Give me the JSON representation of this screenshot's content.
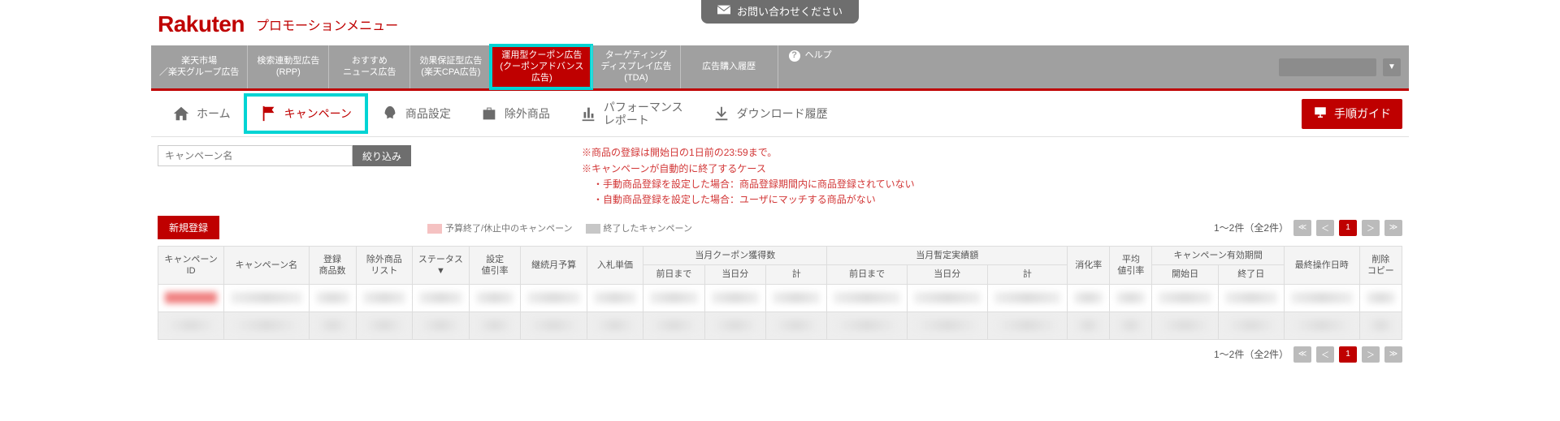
{
  "contact_label": "お問い合わせください",
  "logo": "Rakuten",
  "page_title": "プロモーションメニュー",
  "gnav": [
    {
      "l1": "楽天市場",
      "l2": "／楽天グループ広告"
    },
    {
      "l1": "検索連動型広告",
      "l2": "(RPP)"
    },
    {
      "l1": "おすすめ",
      "l2": "ニュース広告"
    },
    {
      "l1": "効果保証型広告",
      "l2": "(楽天CPA広告)"
    },
    {
      "l1": "運用型クーポン広告",
      "l2": "(クーポンアドバンス",
      "l3": "広告)"
    },
    {
      "l1": "ターゲティング",
      "l2": "ディスプレイ広告",
      "l3": "(TDA)"
    },
    {
      "l1": "広告購入履歴",
      "l2": ""
    },
    {
      "l1": "ヘルプ",
      "l2": ""
    }
  ],
  "snav": {
    "home": "ホーム",
    "campaign": "キャンペーン",
    "product": "商品設定",
    "exclude": "除外商品",
    "perf_l1": "パフォーマンス",
    "perf_l2": "レポート",
    "download": "ダウンロード履歴",
    "guide": "手順ガイド"
  },
  "search": {
    "placeholder": "キャンペーン名",
    "button": "絞り込み"
  },
  "notes": {
    "l1": "※商品の登録は開始日の1日前の23:59まで。",
    "l2": "※キャンペーンが自動的に終了するケース",
    "l3": "・手動商品登録を設定した場合：商品登録期間内に商品登録されていない",
    "l4": "・自動商品登録を設定した場合：ユーザにマッチする商品がない"
  },
  "new_button": "新規登録",
  "legend": {
    "a": "予算終了/休止中のキャンペーン",
    "b": "終了したキャンペーン"
  },
  "pager": {
    "text": "1～2件（全2件）",
    "page": "1"
  },
  "columns": {
    "id": "キャンペーン\nID",
    "name": "キャンペーン名",
    "reg": "登録\n商品数",
    "excl": "除外商品\nリスト",
    "status": "ステータス\n▼",
    "disc": "設定\n値引率",
    "budget": "継続月予算",
    "bid": "入札単価",
    "grp_coupon": "当月クーポン獲得数",
    "grp_amount": "当月暫定実績額",
    "sub_prev": "前日まで",
    "sub_today": "当日分",
    "sub_total": "計",
    "rate": "消化率",
    "avgdisc": "平均\n値引率",
    "grp_period": "キャンペーン有効期間",
    "start": "開始日",
    "end": "終了日",
    "lastop": "最終操作日時",
    "delcopy": "削除\nコピー"
  }
}
